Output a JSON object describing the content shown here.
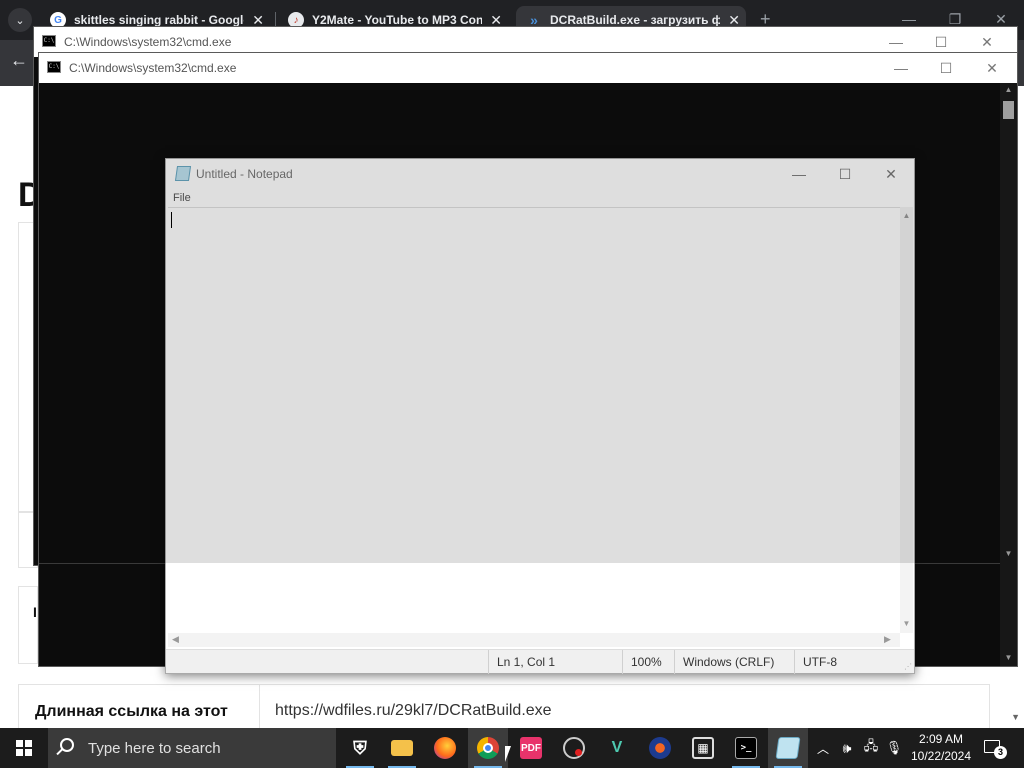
{
  "browser": {
    "tabs": [
      {
        "title": "skittles singing rabbit - Google",
        "favicon": "google-icon",
        "active": false
      },
      {
        "title": "Y2Mate - YouTube to MP3 Con",
        "favicon": "y2mate-icon",
        "active": false
      },
      {
        "title": "DCRatBuild.exe - загрузить фа",
        "favicon": "wdfiles-icon",
        "active": true
      }
    ],
    "new_tab": "+",
    "page": {
      "heading": "D",
      "info_label": "Длинная ссылка на этот",
      "info_value": "https://wdfiles.ru/29kl7/DCRatBuild.exe",
      "side_letter": "I"
    }
  },
  "cmd_back": {
    "title": "C:\\Windows\\system32\\cmd.exe"
  },
  "cmd_front": {
    "title": "C:\\Windows\\system32\\cmd.exe"
  },
  "notepad": {
    "title": "Untitled - Notepad",
    "menu": [
      "File"
    ],
    "status": {
      "position": "Ln 1, Col 1",
      "zoom": "100%",
      "line_ending": "Windows (CRLF)",
      "encoding": "UTF-8"
    }
  },
  "taskbar": {
    "search_placeholder": "Type here to search",
    "apps": [
      {
        "name": "security-app",
        "label": "shield-icon"
      },
      {
        "name": "file-explorer",
        "label": "folder-icon"
      },
      {
        "name": "firefox",
        "label": "firefox-icon"
      },
      {
        "name": "chrome",
        "label": "chrome-icon"
      },
      {
        "name": "pdf-app",
        "label": "pdf-icon"
      },
      {
        "name": "recorder-app",
        "label": "recorder-icon"
      },
      {
        "name": "vs-app",
        "label": "vs-icon"
      },
      {
        "name": "disc-app",
        "label": "disc-icon"
      },
      {
        "name": "video-app",
        "label": "film-icon"
      },
      {
        "name": "terminal",
        "label": "cmd-icon"
      },
      {
        "name": "notepad",
        "label": "notepad-icon"
      }
    ],
    "clock_time": "2:09 AM",
    "clock_date": "10/22/2024",
    "notification_count": "3"
  },
  "colors": {
    "taskbar": "#1c1c1c",
    "cmd_bg": "#0c0c0c",
    "accent": "#76b9ed",
    "tabstrip": "#202124"
  }
}
